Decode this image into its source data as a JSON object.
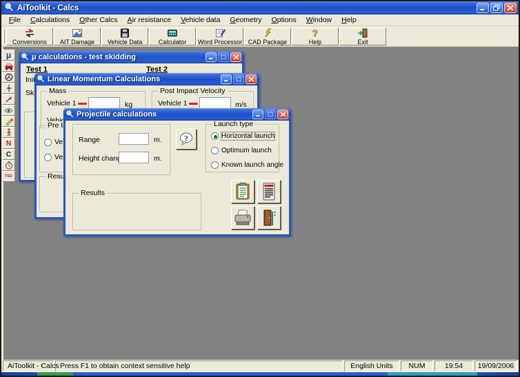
{
  "window": {
    "title": "AiToolkit - Calcs"
  },
  "menu": {
    "items": [
      "File",
      "Calculations",
      "Other Calcs",
      "Air resistance",
      "Vehicle data",
      "Geometry",
      "Options",
      "Window",
      "Help"
    ]
  },
  "toolbar": {
    "buttons": [
      {
        "label": "Conversions",
        "icon": "conversions-icon"
      },
      {
        "label": "AIT Damage",
        "icon": "ait-damage-icon"
      },
      {
        "label": "Vehicle Data",
        "icon": "vehicle-data-icon"
      },
      {
        "label": "Calculator",
        "icon": "calculator-icon"
      },
      {
        "label": "Word Processor",
        "icon": "word-processor-icon"
      },
      {
        "label": "CAD Package",
        "icon": "cad-package-icon"
      },
      {
        "label": "Help",
        "icon": "help-icon"
      },
      {
        "label": "Exit",
        "icon": "exit-icon"
      }
    ]
  },
  "sidebar": {
    "icon_names": [
      "mu-calculations-icon",
      "vehicle-icon",
      "steering-wheel-icon",
      "crosshair-icon",
      "arrow-icon",
      "eye-icon",
      "pencil-tools-icon",
      "pedestrian-icon",
      "north-arrow-icon",
      "curve-icon",
      "stopwatch-icon",
      "tsd-icon"
    ],
    "glyphs": {
      "mu": "μ",
      "north": "N",
      "curve": "C",
      "tsd": "TSD"
    }
  },
  "windows": {
    "mu_calculations": {
      "title": "μ calculations - test skidding",
      "test1_heading": "Test 1",
      "test2_heading": "Test 2",
      "initial_label": "Init",
      "skid_label": "Ski"
    },
    "linear_momentum": {
      "title": "Linear Momentum Calculations",
      "mass_group": {
        "label": "Mass",
        "vehicle1_label": "Vehicle 1",
        "vehicle1_value": "",
        "vehicle1_unit": "kg",
        "vehicle2_label": "Vehic"
      },
      "velocity_group": {
        "label": "Post Impact Velocity",
        "vehicle1_label": "Vehicle 1",
        "vehicle1_value": "",
        "vehicle1_unit": "m/s"
      },
      "pre_impact_group": {
        "label": "Pre Imp",
        "option1": "Veh",
        "option2": "Veh"
      },
      "results_group": {
        "label": "Results"
      }
    },
    "projectile": {
      "title": "Projectile calculations",
      "range_label": "Range",
      "range_value": "",
      "range_unit": "m.",
      "height_label": "Height change ±",
      "height_value": "",
      "height_unit": "m.",
      "launch_group": {
        "label": "Launch type",
        "options": [
          "Horizontal launch",
          "Optimum launch",
          "Known launch angle"
        ],
        "selected": "Horizontal launch"
      },
      "results_group": {
        "label": "Results"
      },
      "action_icons": [
        "clipboard-report-icon",
        "calculator-pad-icon",
        "print-icon",
        "exit-door-icon"
      ]
    }
  },
  "status_bar": {
    "app_name": "AiToolkit - Calcs",
    "help_text": "Press F1 to obtain context sensitive help",
    "units": "English Units",
    "keyboard": "NUM",
    "time": "19:54",
    "date": "19/09/2006"
  },
  "colors": {
    "titlebar_top": "#5a8ae8",
    "titlebar_bottom": "#1e4fc6",
    "window_border": "#2456c8",
    "dialog_bg": "#ece9d8",
    "workspace_bg": "#828282",
    "close_button": "#d8452e",
    "required_dash": "#e02820"
  }
}
